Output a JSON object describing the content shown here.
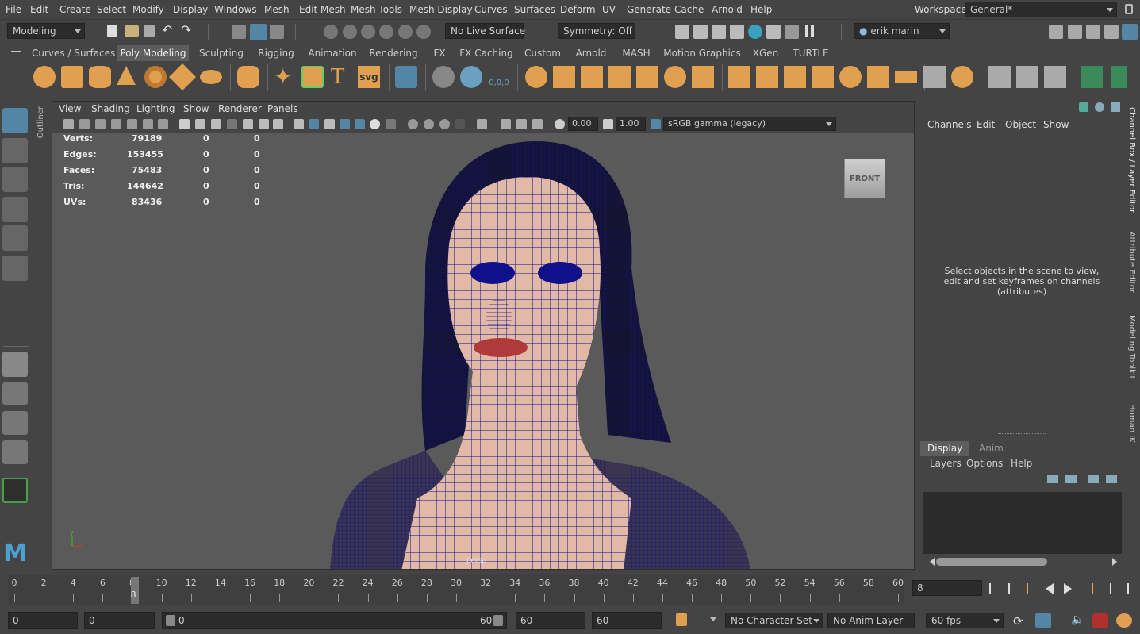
{
  "menubar": {
    "items": [
      "File",
      "Edit",
      "Create",
      "Select",
      "Modify",
      "Display",
      "Windows",
      "Mesh",
      "Edit Mesh",
      "Mesh Tools",
      "Mesh Display",
      "Curves",
      "Surfaces",
      "Deform",
      "UV",
      "Generate",
      "Cache",
      "Arnold",
      "Help"
    ],
    "workspace_label": "Workspace:",
    "workspace_value": "General*"
  },
  "statusline": {
    "mode": "Modeling",
    "live_surface": "No Live Surface",
    "symmetry": "Symmetry: Off",
    "user": "erik marin"
  },
  "shelf": {
    "tabs": [
      "Curves / Surfaces",
      "Poly Modeling",
      "Sculpting",
      "Rigging",
      "Animation",
      "Rendering",
      "FX",
      "FX Caching",
      "Custom",
      "Arnold",
      "MASH",
      "Motion Graphics",
      "XGen",
      "TURTLE"
    ],
    "active_tab": "Poly Modeling",
    "text_icon_t": "T",
    "text_icon_svg": "svg",
    "text_icon_coords": "0,0,0"
  },
  "outliner_tab": "Outliner",
  "viewport": {
    "menus": [
      "View",
      "Shading",
      "Lighting",
      "Show",
      "Renderer",
      "Panels"
    ],
    "exposure": "0.00",
    "gamma": "1.00",
    "color_space": "sRGB gamma (legacy)",
    "camera_label": "persp",
    "viewcube": "FRONT",
    "axis_y": "y",
    "hud": [
      {
        "label": "Verts:",
        "value": "79189",
        "a": "0",
        "b": "0"
      },
      {
        "label": "Edges:",
        "value": "153455",
        "a": "0",
        "b": "0"
      },
      {
        "label": "Faces:",
        "value": "75483",
        "a": "0",
        "b": "0"
      },
      {
        "label": "Tris:",
        "value": "144642",
        "a": "0",
        "b": "0"
      },
      {
        "label": "UVs:",
        "value": "83436",
        "a": "0",
        "b": "0"
      }
    ]
  },
  "channel_box": {
    "menus": [
      "Channels",
      "Edit",
      "Object",
      "Show"
    ],
    "message": "Select objects in the scene to view, edit and set keyframes on channels (attributes)"
  },
  "layer_editor": {
    "tabs": [
      "Display",
      "Anim"
    ],
    "active_tab": "Display",
    "menus": [
      "Layers",
      "Options",
      "Help"
    ]
  },
  "right_tabs": [
    "Channel Box / Layer Editor",
    "Attribute Editor",
    "Modeling Toolkit",
    "Human IK"
  ],
  "timeline": {
    "ticks": [
      "0",
      "2",
      "4",
      "6",
      "8",
      "10",
      "12",
      "14",
      "16",
      "18",
      "20",
      "22",
      "24",
      "26",
      "28",
      "30",
      "32",
      "34",
      "36",
      "38",
      "40",
      "42",
      "44",
      "46",
      "48",
      "50",
      "52",
      "54",
      "56",
      "58",
      "60"
    ],
    "current_frame_marker": "8",
    "current_frame_field": "8"
  },
  "range": {
    "start": "0",
    "playback_start": "0",
    "slider_start": "0",
    "slider_end": "60",
    "playback_end": "60",
    "end": "60",
    "character_set": "No Character Set",
    "anim_layer": "No Anim Layer",
    "fps": "60 fps"
  },
  "colors": {
    "accent": "#5285a6",
    "shelf_icon": "#e0a050",
    "wireframe": "#10108a",
    "skin": "#e2b9a6",
    "lips": "#b03a3a"
  }
}
